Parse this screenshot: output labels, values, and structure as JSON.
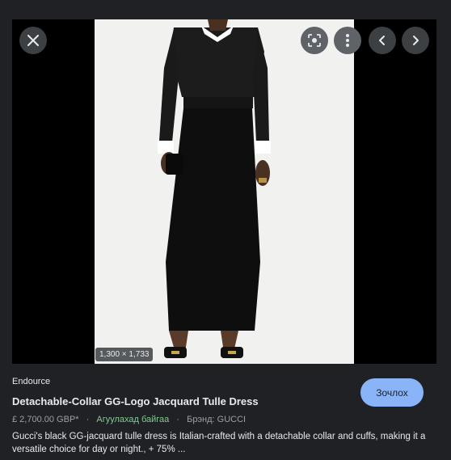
{
  "image": {
    "dimensions": "1,300 × 1,733"
  },
  "controls": {
    "close_icon": "close-icon",
    "lens_icon": "lens-icon",
    "more_icon": "more-vert-icon",
    "prev_icon": "chevron-left-icon",
    "next_icon": "chevron-right-icon"
  },
  "result": {
    "source": "Endource",
    "title": "Detachable-Collar GG-Logo Jacquard Tulle Dress",
    "price": "£ 2,700.00 GBP*",
    "separator": "·",
    "stock": "Агуулахад байгаа",
    "brand": "Брэнд: GUCCI",
    "description": "Gucci's black GG-jacquard tulle dress is Italian-crafted with a detachable collar and cuffs, making it a versatile choice for day or night., + 75% ...",
    "visit_label": "Зочлох"
  },
  "colors": {
    "background": "#202124",
    "accent": "#8ab4f8",
    "stock_green": "#81c995"
  }
}
